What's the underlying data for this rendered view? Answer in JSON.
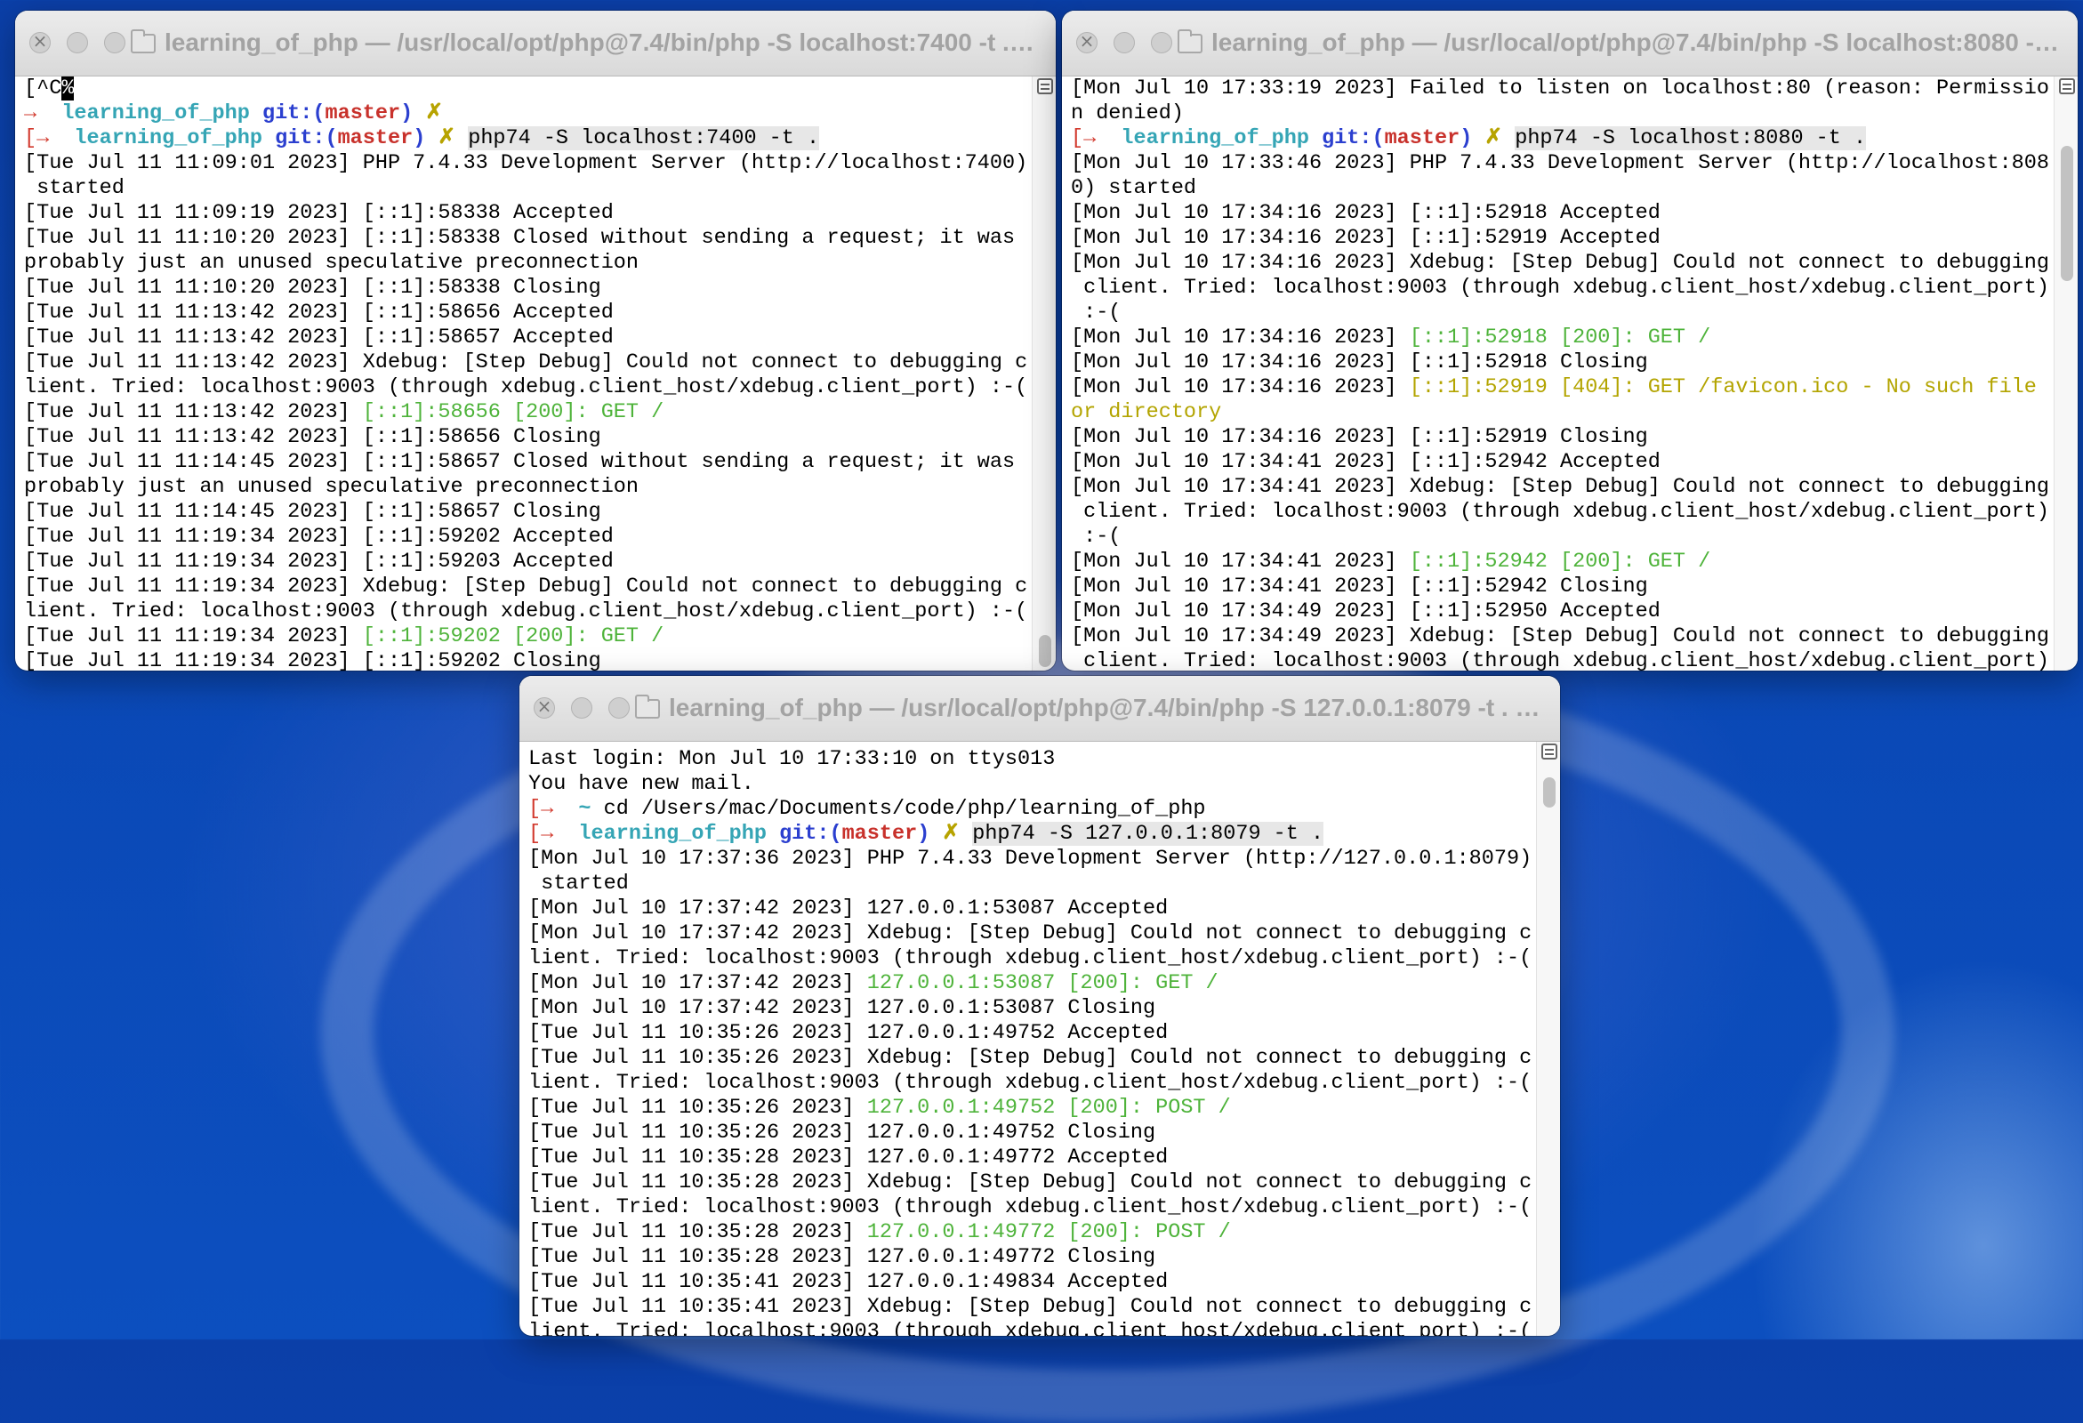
{
  "window1": {
    "title": "learning_of_php — /usr/local/opt/php@7.4/bin/php -S localhost:7400 -t . —...",
    "lines": [
      [
        {
          "t": "[^C"
        },
        {
          "t": "%",
          "s": "cursor"
        }
      ],
      [
        {
          "t": "→ ",
          "s": "arrow"
        },
        {
          "t": " learning_of_php ",
          "s": "cyan"
        },
        {
          "t": "git:(",
          "s": "blue"
        },
        {
          "t": "master",
          "s": "red"
        },
        {
          "t": ")",
          "s": "blue"
        },
        {
          "t": " ✗",
          "s": "x"
        }
      ],
      [
        {
          "t": "[→ ",
          "s": "arrow"
        },
        {
          "t": " learning_of_php ",
          "s": "cyan"
        },
        {
          "t": "git:(",
          "s": "blue"
        },
        {
          "t": "master",
          "s": "red"
        },
        {
          "t": ")",
          "s": "blue"
        },
        {
          "t": " ✗ ",
          "s": "x"
        },
        {
          "t": "php74 -S localhost:7400 -t .",
          "s": "cmdbox"
        }
      ],
      [
        {
          "t": "[Tue Jul 11 11:09:01 2023] PHP 7.4.33 Development Server (http://localhost:7400)"
        }
      ],
      [
        {
          "t": " started"
        }
      ],
      [
        {
          "t": "[Tue Jul 11 11:09:19 2023] [::1]:58338 Accepted"
        }
      ],
      [
        {
          "t": "[Tue Jul 11 11:10:20 2023] [::1]:58338 Closed without sending a request; it was"
        }
      ],
      [
        {
          "t": "probably just an unused speculative preconnection"
        }
      ],
      [
        {
          "t": "[Tue Jul 11 11:10:20 2023] [::1]:58338 Closing"
        }
      ],
      [
        {
          "t": "[Tue Jul 11 11:13:42 2023] [::1]:58656 Accepted"
        }
      ],
      [
        {
          "t": "[Tue Jul 11 11:13:42 2023] [::1]:58657 Accepted"
        }
      ],
      [
        {
          "t": "[Tue Jul 11 11:13:42 2023] Xdebug: [Step Debug] Could not connect to debugging c"
        }
      ],
      [
        {
          "t": "lient. Tried: localhost:9003 (through xdebug.client_host/xdebug.client_port) :-("
        }
      ],
      [
        {
          "t": "[Tue Jul 11 11:13:42 2023] "
        },
        {
          "t": "[::1]:58656 [200]: GET /",
          "s": "g"
        }
      ],
      [
        {
          "t": "[Tue Jul 11 11:13:42 2023] [::1]:58656 Closing"
        }
      ],
      [
        {
          "t": "[Tue Jul 11 11:14:45 2023] [::1]:58657 Closed without sending a request; it was"
        }
      ],
      [
        {
          "t": "probably just an unused speculative preconnection"
        }
      ],
      [
        {
          "t": "[Tue Jul 11 11:14:45 2023] [::1]:58657 Closing"
        }
      ],
      [
        {
          "t": "[Tue Jul 11 11:19:34 2023] [::1]:59202 Accepted"
        }
      ],
      [
        {
          "t": "[Tue Jul 11 11:19:34 2023] [::1]:59203 Accepted"
        }
      ],
      [
        {
          "t": "[Tue Jul 11 11:19:34 2023] Xdebug: [Step Debug] Could not connect to debugging c"
        }
      ],
      [
        {
          "t": "lient. Tried: localhost:9003 (through xdebug.client_host/xdebug.client_port) :-("
        }
      ],
      [
        {
          "t": "[Tue Jul 11 11:19:34 2023] "
        },
        {
          "t": "[::1]:59202 [200]: GET /",
          "s": "g"
        }
      ],
      [
        {
          "t": "[Tue Jul 11 11:19:34 2023] [::1]:59202 Closing"
        }
      ]
    ]
  },
  "window2": {
    "title": "learning_of_php — /usr/local/opt/php@7.4/bin/php -S localhost:8080 -t ....",
    "lines": [
      [
        {
          "t": "[Mon Jul 10 17:33:19 2023] Failed to listen on localhost:80 (reason: Permissio"
        }
      ],
      [
        {
          "t": "n denied)"
        }
      ],
      [
        {
          "t": "[→ ",
          "s": "arrow"
        },
        {
          "t": " learning_of_php ",
          "s": "cyan"
        },
        {
          "t": "git:(",
          "s": "blue"
        },
        {
          "t": "master",
          "s": "red"
        },
        {
          "t": ")",
          "s": "blue"
        },
        {
          "t": " ✗ ",
          "s": "x"
        },
        {
          "t": "php74 -S localhost:8080 -t .",
          "s": "cmdbox"
        }
      ],
      [
        {
          "t": "[Mon Jul 10 17:33:46 2023] PHP 7.4.33 Development Server (http://localhost:808"
        }
      ],
      [
        {
          "t": "0) started"
        }
      ],
      [
        {
          "t": "[Mon Jul 10 17:34:16 2023] [::1]:52918 Accepted"
        }
      ],
      [
        {
          "t": "[Mon Jul 10 17:34:16 2023] [::1]:52919 Accepted"
        }
      ],
      [
        {
          "t": "[Mon Jul 10 17:34:16 2023] Xdebug: [Step Debug] Could not connect to debugging"
        }
      ],
      [
        {
          "t": " client. Tried: localhost:9003 (through xdebug.client_host/xdebug.client_port)"
        }
      ],
      [
        {
          "t": " :-("
        }
      ],
      [
        {
          "t": "[Mon Jul 10 17:34:16 2023] "
        },
        {
          "t": "[::1]:52918 [200]: GET /",
          "s": "g"
        }
      ],
      [
        {
          "t": "[Mon Jul 10 17:34:16 2023] [::1]:52918 Closing"
        }
      ],
      [
        {
          "t": "[Mon Jul 10 17:34:16 2023] "
        },
        {
          "t": "[::1]:52919 [404]: GET /favicon.ico - No such file",
          "s": "y"
        }
      ],
      [
        {
          "t": "or directory",
          "s": "y"
        }
      ],
      [
        {
          "t": "[Mon Jul 10 17:34:16 2023] [::1]:52919 Closing"
        }
      ],
      [
        {
          "t": "[Mon Jul 10 17:34:41 2023] [::1]:52942 Accepted"
        }
      ],
      [
        {
          "t": "[Mon Jul 10 17:34:41 2023] Xdebug: [Step Debug] Could not connect to debugging"
        }
      ],
      [
        {
          "t": " client. Tried: localhost:9003 (through xdebug.client_host/xdebug.client_port)"
        }
      ],
      [
        {
          "t": " :-("
        }
      ],
      [
        {
          "t": "[Mon Jul 10 17:34:41 2023] "
        },
        {
          "t": "[::1]:52942 [200]: GET /",
          "s": "g"
        }
      ],
      [
        {
          "t": "[Mon Jul 10 17:34:41 2023] [::1]:52942 Closing"
        }
      ],
      [
        {
          "t": "[Mon Jul 10 17:34:49 2023] [::1]:52950 Accepted"
        }
      ],
      [
        {
          "t": "[Mon Jul 10 17:34:49 2023] Xdebug: [Step Debug] Could not connect to debugging"
        }
      ],
      [
        {
          "t": " client. Tried: localhost:9003 (through xdebug.client_host/xdebug.client_port)"
        }
      ]
    ]
  },
  "window3": {
    "title": "learning_of_php — /usr/local/opt/php@7.4/bin/php -S 127.0.0.1:8079 -t . — p...",
    "lines": [
      [
        {
          "t": "Last login: Mon Jul 10 17:33:10 on ttys013"
        }
      ],
      [
        {
          "t": "You have new mail."
        }
      ],
      [
        {
          "t": "[→ ",
          "s": "arrow"
        },
        {
          "t": " ~ ",
          "s": "cyan"
        },
        {
          "t": "cd /Users/mac/Documents/code/php/learning_of_php"
        }
      ],
      [
        {
          "t": "[→ ",
          "s": "arrow"
        },
        {
          "t": " learning_of_php ",
          "s": "cyan"
        },
        {
          "t": "git:(",
          "s": "blue"
        },
        {
          "t": "master",
          "s": "red"
        },
        {
          "t": ")",
          "s": "blue"
        },
        {
          "t": " ✗ ",
          "s": "x"
        },
        {
          "t": "php74 -S 127.0.0.1:8079 -t .",
          "s": "cmdbox"
        }
      ],
      [
        {
          "t": "[Mon Jul 10 17:37:36 2023] PHP 7.4.33 Development Server (http://127.0.0.1:8079)"
        }
      ],
      [
        {
          "t": " started"
        }
      ],
      [
        {
          "t": "[Mon Jul 10 17:37:42 2023] 127.0.0.1:53087 Accepted"
        }
      ],
      [
        {
          "t": "[Mon Jul 10 17:37:42 2023] Xdebug: [Step Debug] Could not connect to debugging c"
        }
      ],
      [
        {
          "t": "lient. Tried: localhost:9003 (through xdebug.client_host/xdebug.client_port) :-("
        }
      ],
      [
        {
          "t": "[Mon Jul 10 17:37:42 2023] "
        },
        {
          "t": "127.0.0.1:53087 [200]: GET /",
          "s": "g"
        }
      ],
      [
        {
          "t": "[Mon Jul 10 17:37:42 2023] 127.0.0.1:53087 Closing"
        }
      ],
      [
        {
          "t": "[Tue Jul 11 10:35:26 2023] 127.0.0.1:49752 Accepted"
        }
      ],
      [
        {
          "t": "[Tue Jul 11 10:35:26 2023] Xdebug: [Step Debug] Could not connect to debugging c"
        }
      ],
      [
        {
          "t": "lient. Tried: localhost:9003 (through xdebug.client_host/xdebug.client_port) :-("
        }
      ],
      [
        {
          "t": "[Tue Jul 11 10:35:26 2023] "
        },
        {
          "t": "127.0.0.1:49752 [200]: POST /",
          "s": "g"
        }
      ],
      [
        {
          "t": "[Tue Jul 11 10:35:26 2023] 127.0.0.1:49752 Closing"
        }
      ],
      [
        {
          "t": "[Tue Jul 11 10:35:28 2023] 127.0.0.1:49772 Accepted"
        }
      ],
      [
        {
          "t": "[Tue Jul 11 10:35:28 2023] Xdebug: [Step Debug] Could not connect to debugging c"
        }
      ],
      [
        {
          "t": "lient. Tried: localhost:9003 (through xdebug.client_host/xdebug.client_port) :-("
        }
      ],
      [
        {
          "t": "[Tue Jul 11 10:35:28 2023] "
        },
        {
          "t": "127.0.0.1:49772 [200]: POST /",
          "s": "g"
        }
      ],
      [
        {
          "t": "[Tue Jul 11 10:35:28 2023] 127.0.0.1:49772 Closing"
        }
      ],
      [
        {
          "t": "[Tue Jul 11 10:35:41 2023] 127.0.0.1:49834 Accepted"
        }
      ],
      [
        {
          "t": "[Tue Jul 11 10:35:41 2023] Xdebug: [Step Debug] Could not connect to debugging c"
        }
      ],
      [
        {
          "t": "lient. Tried: localhost:9003 (through xdebug.client_host/xdebug.client_port) :-("
        }
      ]
    ]
  },
  "icons": {
    "close": "close-icon",
    "folder": "folder-icon",
    "scrollbar_menu": "scrollbar-menu-icon"
  }
}
